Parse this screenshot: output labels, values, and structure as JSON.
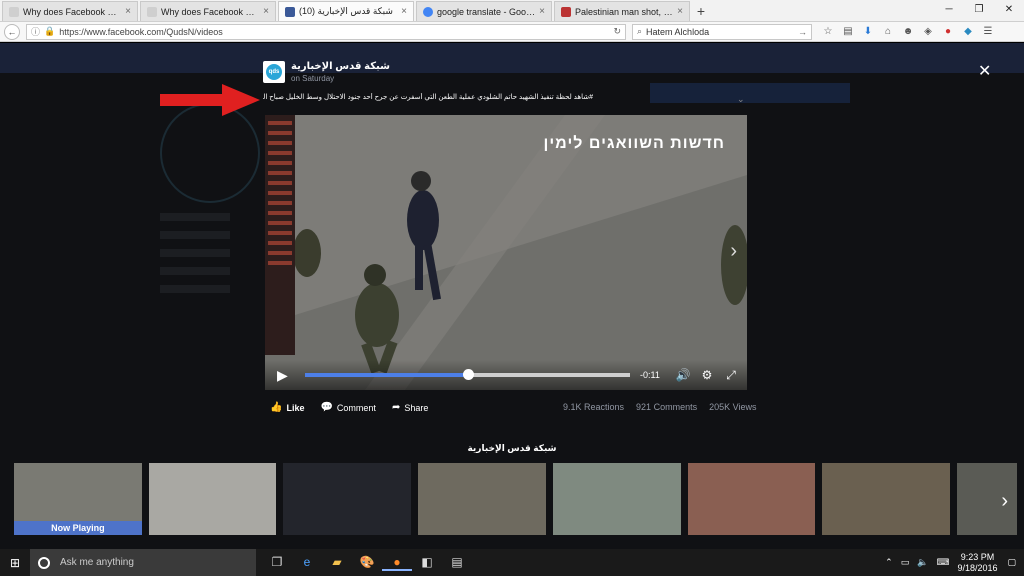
{
  "browser": {
    "tabs": [
      {
        "title": "Why does Facebook enable Pa...",
        "favicon_color": "#cfcfcf"
      },
      {
        "title": "Why does Facebook enable Pa...",
        "favicon_color": "#cfcfcf"
      },
      {
        "title": "(10) شبكة قدس الإخبارية",
        "favicon_color": "#3b5998",
        "active": true
      },
      {
        "title": "google translate - Google ...",
        "favicon_color": "#4285f4"
      },
      {
        "title": "Palestinian man shot, kille...",
        "favicon_color": "#b33"
      }
    ],
    "new_tab": "+",
    "url": "https://www.facebook.com/QudsN/videos",
    "search_value": "Hatem Alchloda"
  },
  "lightbox": {
    "page_name": "شبكة قدس الإخبارية",
    "post_time": "on Saturday",
    "caption": "#شاهد لحظة تنفيذ الشهيد حاتم الشلودي عملية الطعن التي أسفرت عن جرح أحد جنود الاحتلال وسط الخليل صباح اليوم.",
    "video": {
      "overlay_text": "חדשות השוואגים לימין",
      "time_remaining": "-0:11",
      "progress": 0.5
    },
    "actions": {
      "like": "Like",
      "comment": "Comment",
      "share": "Share"
    },
    "stats": {
      "reactions": "9.1K Reactions",
      "comments": "921 Comments",
      "views": "205K Views"
    },
    "carousel": {
      "title": "شبكة قدس الإخبارية",
      "now_playing": "Now Playing",
      "thumbs": [
        {
          "color": "#7a7a73"
        },
        {
          "color": "#a9a8a3"
        },
        {
          "color": "#23252c"
        },
        {
          "color": "#6e6a5f"
        },
        {
          "color": "#7f8a80"
        },
        {
          "color": "#8a5f52"
        },
        {
          "color": "#6a6050"
        },
        {
          "color": "#5a5b55"
        }
      ]
    }
  },
  "taskbar": {
    "search_placeholder": "Ask me anything",
    "time": "9:23 PM",
    "date": "9/18/2016"
  },
  "colors": {
    "accent": "#4d7fe8",
    "now_playing_bg": "#4e73c9",
    "arrow": "#e02020"
  }
}
